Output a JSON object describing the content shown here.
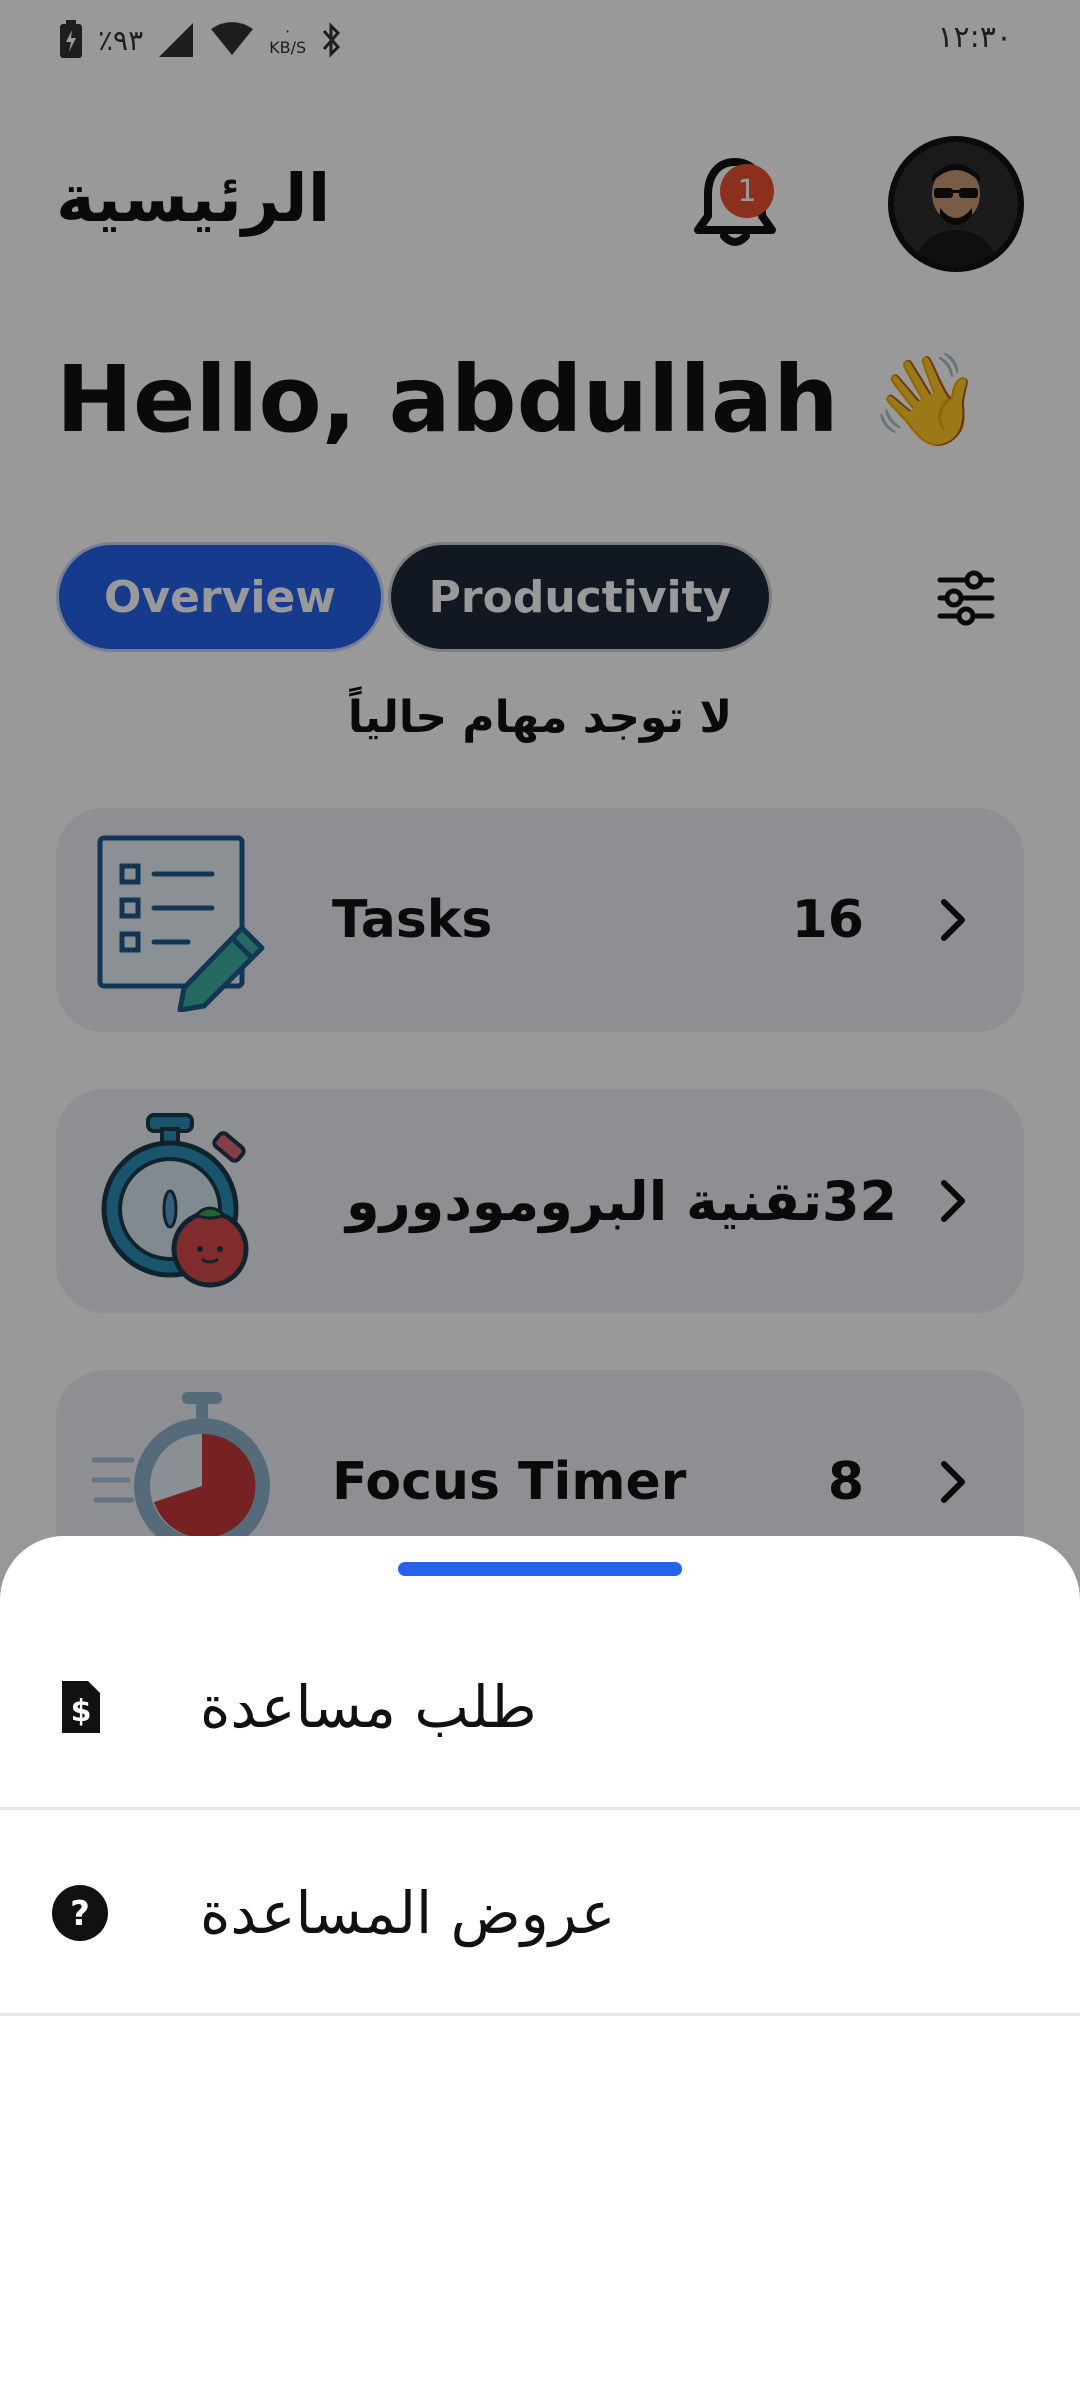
{
  "status_bar": {
    "battery": "٪٩٣",
    "speed_unit": "KB/S",
    "time": "١٢:٣٠"
  },
  "header": {
    "title": "الرئيسية",
    "notification_count": "1"
  },
  "greeting": {
    "text": "Hello, abdullah",
    "emoji": "👋"
  },
  "tabs": [
    {
      "label": "Overview",
      "active": true
    },
    {
      "label": "Productivity",
      "active": false
    }
  ],
  "empty_message": "لا توجد مهام حالياً",
  "cards": [
    {
      "label": "Tasks",
      "count": "16",
      "icon": "task-list-icon"
    },
    {
      "label": "تقنية البرومودورو",
      "count": "32",
      "icon": "pomodoro-timer-icon"
    },
    {
      "label": "Focus Timer",
      "count": "8",
      "icon": "focus-stopwatch-icon"
    }
  ],
  "sheet": {
    "items": [
      {
        "label": "طلب مساعدة",
        "icon": "dollar-document-icon"
      },
      {
        "label": "عروض المساعدة",
        "icon": "question-circle-icon"
      }
    ]
  },
  "colors": {
    "accent": "#2563eb",
    "dark_tab": "#1f2937",
    "badge": "#e8512f",
    "card_bg": "#eceef3"
  }
}
